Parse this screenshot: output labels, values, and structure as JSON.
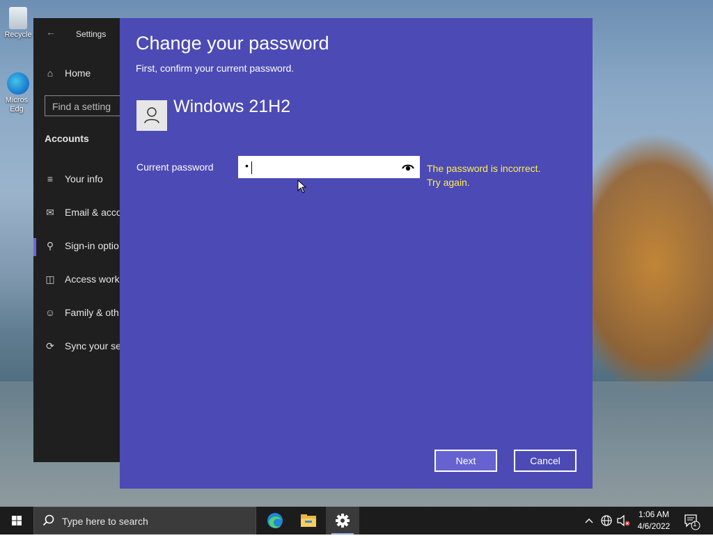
{
  "desktop": {
    "icons": [
      {
        "label": "Recycle"
      },
      {
        "label": "Micros Edg"
      }
    ]
  },
  "settings": {
    "title": "Settings",
    "home": "Home",
    "search_placeholder": "Find a setting",
    "section": "Accounts",
    "nav": [
      {
        "label": "Your info",
        "icon": "person-card-icon"
      },
      {
        "label": "Email & acco",
        "icon": "mail-icon"
      },
      {
        "label": "Sign-in optio",
        "icon": "key-icon"
      },
      {
        "label": "Access work",
        "icon": "briefcase-icon"
      },
      {
        "label": "Family & oth",
        "icon": "person-add-icon"
      },
      {
        "label": "Sync your se",
        "icon": "sync-icon"
      }
    ]
  },
  "dialog": {
    "title": "Change your password",
    "subtitle": "First, confirm your current password.",
    "user_name": "Windows 21H2",
    "password_label": "Current password",
    "password_masked": "•",
    "error_line1": "The password is incorrect.",
    "error_line2": "Try again.",
    "next_label": "Next",
    "cancel_label": "Cancel",
    "error_color": "#ffee58",
    "accent": "#4c4ab5"
  },
  "taskbar": {
    "search_placeholder": "Type here to search",
    "apps": [
      "edge-icon",
      "file-explorer-icon",
      "settings-gear-icon"
    ],
    "clock_time": "1:06 AM",
    "clock_date": "4/6/2022",
    "notification_count": "1"
  }
}
